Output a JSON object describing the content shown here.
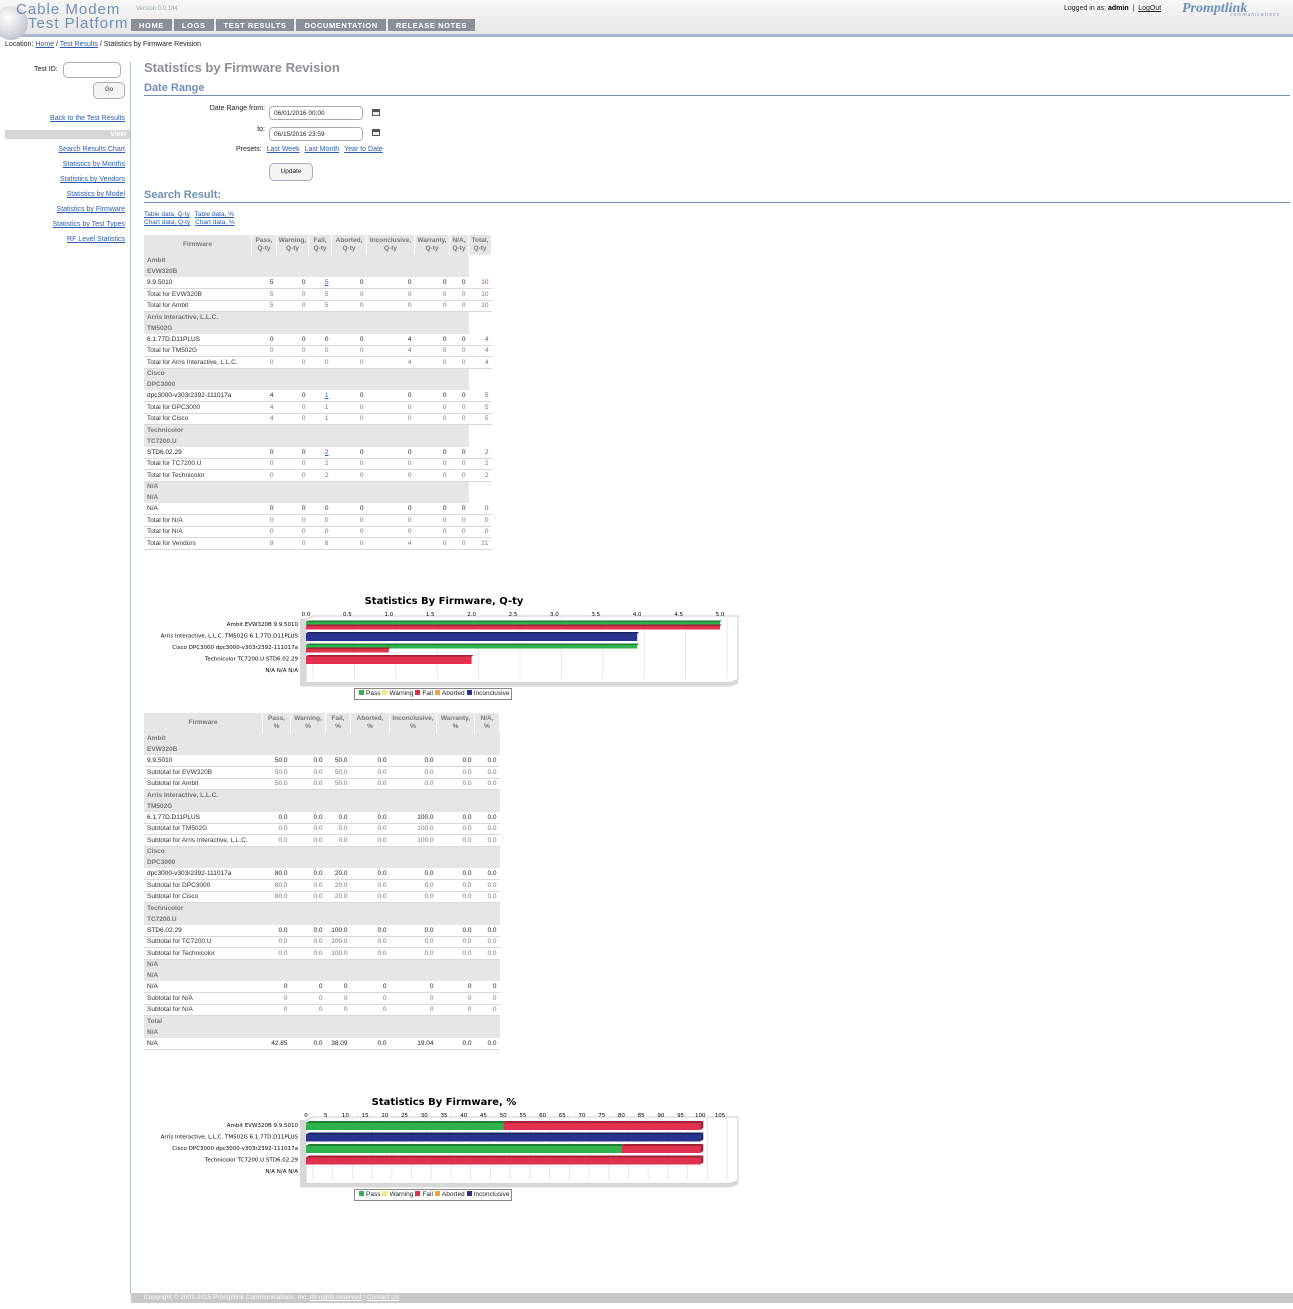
{
  "header": {
    "logo_line1": "Cable Modem",
    "logo_line2": "Test Platform",
    "version": "Version 0.0.184",
    "nav": [
      "HOME",
      "LOGS",
      "TEST RESULTS",
      "DOCUMENTATION",
      "RELEASE NOTES"
    ],
    "login_prefix": "Logged in as:",
    "user": "admin",
    "logout": "LogOut",
    "brand": "Promptlink",
    "brand_sub": "communications"
  },
  "breadcrumb": {
    "prefix": "Location:",
    "home": "Home",
    "results": "Test Results",
    "current": "Statistics by Firmware Revision"
  },
  "sidebar": {
    "test_id_label": "Test ID:",
    "go": "Go",
    "back": "Back to the Test Results",
    "view": "View",
    "links": [
      "Search Results Chart",
      "Statistics by Months",
      "Statistics by Vendors",
      "Statistics by Model",
      "Statistics by Firmware",
      "Statistics by Test Types",
      "RF Level Statistics"
    ]
  },
  "main": {
    "title": "Statistics by Firmware Revision",
    "date_range": "Date Range",
    "from_label": "Date Range from:",
    "to_label": "to:",
    "from_value": "06/01/2016 00:00",
    "to_value": "06/15/2016 23:59",
    "presets_label": "Presets:",
    "presets": [
      "Last Week",
      "Last Month",
      "Year to Date"
    ],
    "update": "Update",
    "search_result": "Search Result:",
    "data_links": [
      "Table data, Q-ty",
      "Table data, %",
      "Chart data, Q-ty",
      "Chart data, %"
    ]
  },
  "qty_table": {
    "headers": [
      [
        "Firmware"
      ],
      [
        "Pass,",
        "Q-ty"
      ],
      [
        "Warning,",
        "Q-ty"
      ],
      [
        "Fail,",
        "Q-ty"
      ],
      [
        "Aborted,",
        "Q-ty"
      ],
      [
        "Inconclusive,",
        "Q-ty"
      ],
      [
        "Warranty,",
        "Q-ty"
      ],
      [
        "N/A,",
        "Q-ty"
      ],
      [
        "Total,",
        "Q-ty"
      ]
    ],
    "rows": [
      {
        "type": "grp",
        "label": "Ambit"
      },
      {
        "type": "grp",
        "label": "EVW320B"
      },
      {
        "type": "data",
        "label": "9.9.5010",
        "vals": [
          "5",
          "0",
          "5",
          "0",
          "0",
          "0",
          "0",
          "10"
        ],
        "link": 2
      },
      {
        "type": "sub",
        "label": "Total for EVW320B",
        "vals": [
          "5",
          "0",
          "5",
          "0",
          "0",
          "0",
          "0",
          "10"
        ]
      },
      {
        "type": "sub",
        "label": "Total for Ambit",
        "vals": [
          "5",
          "0",
          "5",
          "0",
          "0",
          "0",
          "0",
          "10"
        ]
      },
      {
        "type": "grp",
        "label": "Arris Interactive, L.L.C."
      },
      {
        "type": "grp",
        "label": "TM502G"
      },
      {
        "type": "data",
        "label": "6.1.77D.D11PLUS",
        "vals": [
          "0",
          "0",
          "0",
          "0",
          "4",
          "0",
          "0",
          "4"
        ]
      },
      {
        "type": "sub",
        "label": "Total for TM502G",
        "vals": [
          "0",
          "0",
          "0",
          "0",
          "4",
          "0",
          "0",
          "4"
        ]
      },
      {
        "type": "sub",
        "label": "Total for Arris Interactive, L.L.C.",
        "vals": [
          "0",
          "0",
          "0",
          "0",
          "4",
          "0",
          "0",
          "4"
        ]
      },
      {
        "type": "grp",
        "label": "Cisco"
      },
      {
        "type": "grp",
        "label": "DPC3000"
      },
      {
        "type": "data",
        "label": "dpc3000-v303r2392-111017a",
        "vals": [
          "4",
          "0",
          "1",
          "0",
          "0",
          "0",
          "0",
          "5"
        ],
        "link": 2
      },
      {
        "type": "sub",
        "label": "Total for DPC3000",
        "vals": [
          "4",
          "0",
          "1",
          "0",
          "0",
          "0",
          "0",
          "5"
        ]
      },
      {
        "type": "sub",
        "label": "Total for Cisco",
        "vals": [
          "4",
          "0",
          "1",
          "0",
          "0",
          "0",
          "0",
          "5"
        ]
      },
      {
        "type": "grp",
        "label": "Technicolor"
      },
      {
        "type": "grp",
        "label": "TC7200.U"
      },
      {
        "type": "data",
        "label": "STD6.02.29",
        "vals": [
          "0",
          "0",
          "2",
          "0",
          "0",
          "0",
          "0",
          "2"
        ],
        "link": 2
      },
      {
        "type": "sub",
        "label": "Total for TC7200.U",
        "vals": [
          "0",
          "0",
          "2",
          "0",
          "0",
          "0",
          "0",
          "2"
        ]
      },
      {
        "type": "sub",
        "label": "Total for Technicolor",
        "vals": [
          "0",
          "0",
          "2",
          "0",
          "0",
          "0",
          "0",
          "2"
        ]
      },
      {
        "type": "grp",
        "label": "N/A"
      },
      {
        "type": "grp",
        "label": "N/A"
      },
      {
        "type": "data",
        "label": "N/A",
        "vals": [
          "0",
          "0",
          "0",
          "0",
          "0",
          "0",
          "0",
          "0"
        ]
      },
      {
        "type": "sub",
        "label": "Total for N/A",
        "vals": [
          "0",
          "0",
          "0",
          "0",
          "0",
          "0",
          "0",
          "0"
        ]
      },
      {
        "type": "sub",
        "label": "Total for N/A",
        "vals": [
          "0",
          "0",
          "0",
          "0",
          "0",
          "0",
          "0",
          "0"
        ]
      },
      {
        "type": "sub",
        "label": "Total for Vendors",
        "vals": [
          "9",
          "0",
          "8",
          "0",
          "4",
          "0",
          "0",
          "21"
        ]
      }
    ]
  },
  "pct_table": {
    "headers": [
      [
        "Firmware"
      ],
      [
        "Pass,",
        "%"
      ],
      [
        "Warning,",
        "%"
      ],
      [
        "Fail,",
        "%"
      ],
      [
        "Aborted,",
        "%"
      ],
      [
        "Inconclusive,",
        "%"
      ],
      [
        "Warranty,",
        "%"
      ],
      [
        "N/A,",
        "%"
      ]
    ],
    "rows": [
      {
        "type": "grp",
        "label": "Ambit"
      },
      {
        "type": "grp",
        "label": "EVW320B"
      },
      {
        "type": "data",
        "label": "9.9.5010",
        "vals": [
          "50.0",
          "0.0",
          "50.0",
          "0.0",
          "0.0",
          "0.0",
          "0.0"
        ]
      },
      {
        "type": "sub",
        "label": "Subtotal for EVW320B",
        "vals": [
          "50.0",
          "0.0",
          "50.0",
          "0.0",
          "0.0",
          "0.0",
          "0.0"
        ]
      },
      {
        "type": "sub",
        "label": "Subtotal for Ambit",
        "vals": [
          "50.0",
          "0.0",
          "50.0",
          "0.0",
          "0.0",
          "0.0",
          "0.0"
        ]
      },
      {
        "type": "grp",
        "label": "Arris Interactive, L.L.C."
      },
      {
        "type": "grp",
        "label": "TM502G"
      },
      {
        "type": "data",
        "label": "6.1.77D.D11PLUS",
        "vals": [
          "0.0",
          "0.0",
          "0.0",
          "0.0",
          "100.0",
          "0.0",
          "0.0"
        ]
      },
      {
        "type": "sub",
        "label": "Subtotal for TM502G",
        "vals": [
          "0.0",
          "0.0",
          "0.0",
          "0.0",
          "100.0",
          "0.0",
          "0.0"
        ]
      },
      {
        "type": "sub",
        "label": "Subtotal for Arris Interactive, L.L.C.",
        "vals": [
          "0.0",
          "0.0",
          "0.0",
          "0.0",
          "100.0",
          "0.0",
          "0.0"
        ]
      },
      {
        "type": "grp",
        "label": "Cisco"
      },
      {
        "type": "grp",
        "label": "DPC3000"
      },
      {
        "type": "data",
        "label": "dpc3000-v303r2392-111017a",
        "vals": [
          "80.0",
          "0.0",
          "20.0",
          "0.0",
          "0.0",
          "0.0",
          "0.0"
        ]
      },
      {
        "type": "sub",
        "label": "Subtotal for DPC3000",
        "vals": [
          "80.0",
          "0.0",
          "20.0",
          "0.0",
          "0.0",
          "0.0",
          "0.0"
        ]
      },
      {
        "type": "sub",
        "label": "Subtotal for Cisco",
        "vals": [
          "80.0",
          "0.0",
          "20.0",
          "0.0",
          "0.0",
          "0.0",
          "0.0"
        ]
      },
      {
        "type": "grp",
        "label": "Technicolor"
      },
      {
        "type": "grp",
        "label": "TC7200.U"
      },
      {
        "type": "data",
        "label": "STD6.02.29",
        "vals": [
          "0.0",
          "0.0",
          "100.0",
          "0.0",
          "0.0",
          "0.0",
          "0.0"
        ]
      },
      {
        "type": "sub",
        "label": "Subtotal for TC7200.U",
        "vals": [
          "0.0",
          "0.0",
          "100.0",
          "0.0",
          "0.0",
          "0.0",
          "0.0"
        ]
      },
      {
        "type": "sub",
        "label": "Subtotal for Technicolor",
        "vals": [
          "0.0",
          "0.0",
          "100.0",
          "0.0",
          "0.0",
          "0.0",
          "0.0"
        ]
      },
      {
        "type": "grp",
        "label": "N/A"
      },
      {
        "type": "grp",
        "label": "N/A"
      },
      {
        "type": "data",
        "label": "N/A",
        "vals": [
          "0",
          "0",
          "0",
          "0",
          "0",
          "0",
          "0"
        ]
      },
      {
        "type": "sub",
        "label": "Subtotal for N/A",
        "vals": [
          "0",
          "0",
          "0",
          "0",
          "0",
          "0",
          "0"
        ]
      },
      {
        "type": "sub",
        "label": "Subtotal for N/A",
        "vals": [
          "0",
          "0",
          "0",
          "0",
          "0",
          "0",
          "0"
        ]
      },
      {
        "type": "grp",
        "label": "Total"
      },
      {
        "type": "grp",
        "label": "N/A"
      },
      {
        "type": "data",
        "label": "N/A",
        "vals": [
          "42.85",
          "0.0",
          "38.09",
          "0.0",
          "19.04",
          "0.0",
          "0.0"
        ]
      }
    ]
  },
  "colors": {
    "pass": "#2db34a",
    "warning": "#f3e98a",
    "fail": "#e2304f",
    "aborted": "#f3a13b",
    "inconclusive": "#27338c"
  },
  "chart_data": [
    {
      "type": "bar",
      "orientation": "horizontal",
      "title": "Statistics By Firmware, Q-ty",
      "categories": [
        "Ambit EVW320B 9.9.5010",
        "Arris Interactive, L.L.C. TM502G 6.1.77D.D11PLUS",
        "Cisco DPC3000 dpc3000-v303r2392-111017a",
        "Technicolor TC7200.U STD6.02.29",
        "N/A N/A N/A"
      ],
      "xlim": [
        0,
        5.0
      ],
      "ticks": [
        "0.0",
        "0.5",
        "1.0",
        "1.5",
        "2.0",
        "2.5",
        "3.0",
        "3.5",
        "4.0",
        "4.5",
        "5.0"
      ],
      "tick_values": [
        0,
        0.5,
        1,
        1.5,
        2,
        2.5,
        3,
        3.5,
        4,
        4.5,
        5
      ],
      "legend": "bottom",
      "series": [
        {
          "name": "Pass",
          "values": [
            5,
            0,
            4,
            0,
            0
          ]
        },
        {
          "name": "Warning",
          "values": [
            0,
            0,
            0,
            0,
            0
          ]
        },
        {
          "name": "Fail",
          "values": [
            5,
            0,
            1,
            2,
            0
          ]
        },
        {
          "name": "Aborted",
          "values": [
            0,
            0,
            0,
            0,
            0
          ]
        },
        {
          "name": "Inconclusive",
          "values": [
            0,
            4,
            0,
            0,
            0
          ]
        }
      ]
    },
    {
      "type": "bar",
      "orientation": "horizontal",
      "stacked": true,
      "title": "Statistics By Firmware, %",
      "categories": [
        "Ambit EVW320B 9.9.5010",
        "Arris Interactive, L.L.C. TM502G 6.1.77D.D11PLUS",
        "Cisco DPC3000 dpc3000-v303r2392-111017a",
        "Technicolor TC7200.U STD6.02.29",
        "N/A N/A N/A"
      ],
      "xlim": [
        0,
        105
      ],
      "ticks": [
        "0",
        "5",
        "10",
        "15",
        "20",
        "25",
        "30",
        "35",
        "40",
        "45",
        "50",
        "55",
        "60",
        "65",
        "70",
        "75",
        "80",
        "85",
        "90",
        "95",
        "100",
        "105"
      ],
      "tick_values": [
        0,
        5,
        10,
        15,
        20,
        25,
        30,
        35,
        40,
        45,
        50,
        55,
        60,
        65,
        70,
        75,
        80,
        85,
        90,
        95,
        100,
        105
      ],
      "legend": "bottom",
      "series": [
        {
          "name": "Pass",
          "values": [
            50,
            0,
            80,
            0,
            0
          ]
        },
        {
          "name": "Warning",
          "values": [
            0,
            0,
            0,
            0,
            0
          ]
        },
        {
          "name": "Fail",
          "values": [
            50,
            0,
            20,
            100,
            0
          ]
        },
        {
          "name": "Aborted",
          "values": [
            0,
            0,
            0,
            0,
            0
          ]
        },
        {
          "name": "Inconclusive",
          "values": [
            0,
            100,
            0,
            0,
            0
          ]
        }
      ]
    }
  ],
  "footer": {
    "copyright": "Copyright © 2001-2015 Promptlink Communications, Inc.",
    "rights": "All rights reserved",
    "contact": "Contact Us"
  }
}
